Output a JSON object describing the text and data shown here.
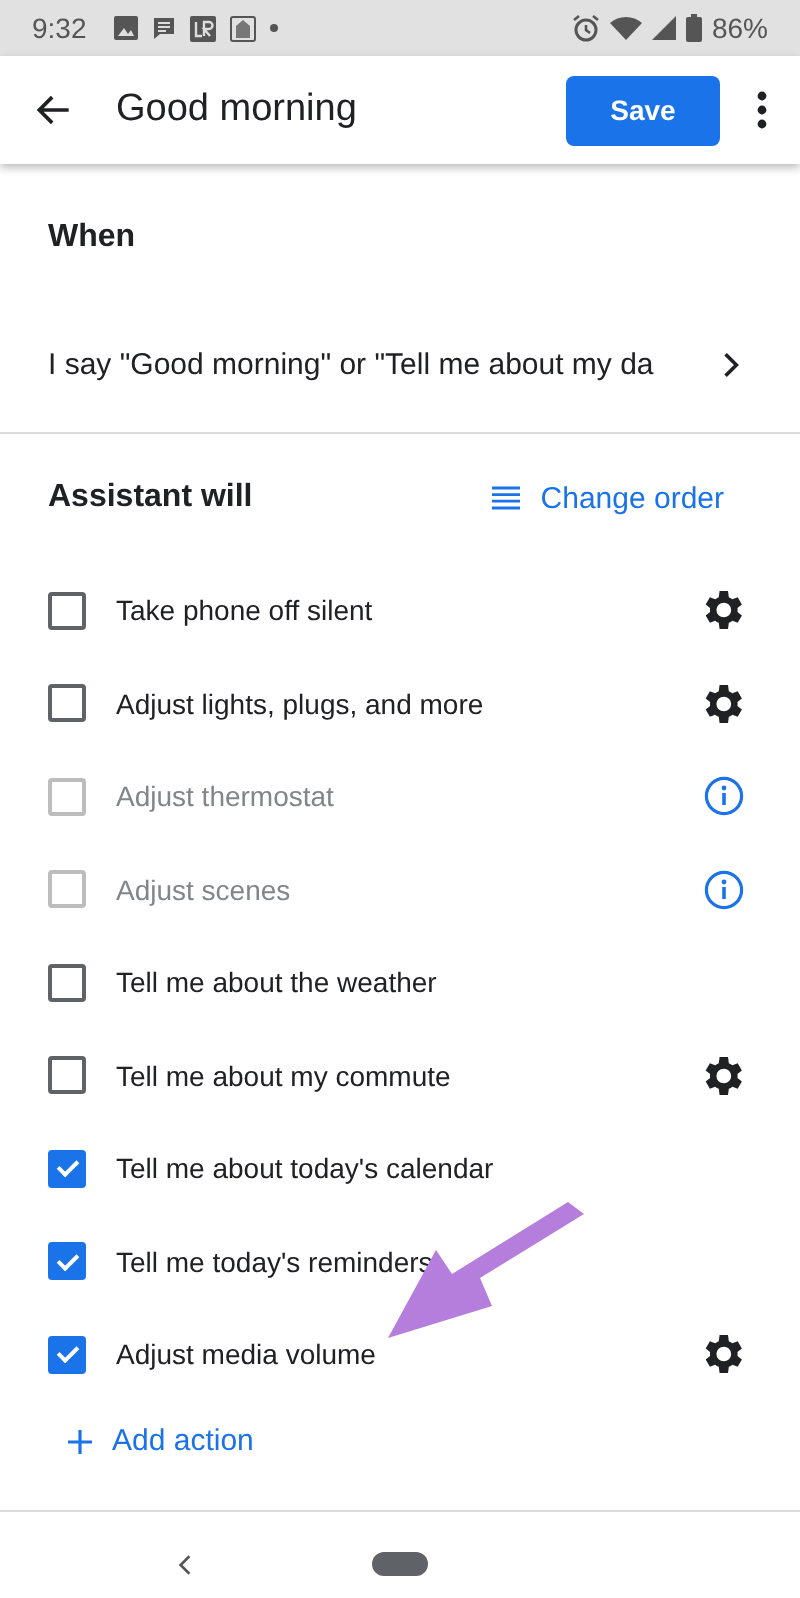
{
  "status_bar": {
    "time": "9:32",
    "battery": "86%"
  },
  "app_bar": {
    "title": "Good morning",
    "save_label": "Save"
  },
  "when": {
    "heading": "When",
    "trigger": "I say \"Good morning\" or \"Tell me about my da"
  },
  "actions_section": {
    "heading": "Assistant will",
    "change_order": "Change order",
    "add_action": "Add action"
  },
  "actions": [
    {
      "label": "Take phone off silent",
      "checked": false,
      "disabled": false,
      "kind": "gear"
    },
    {
      "label": "Adjust lights, plugs, and more",
      "checked": false,
      "disabled": false,
      "kind": "gear"
    },
    {
      "label": "Adjust thermostat",
      "checked": false,
      "disabled": true,
      "kind": "info"
    },
    {
      "label": "Adjust scenes",
      "checked": false,
      "disabled": true,
      "kind": "info"
    },
    {
      "label": "Tell me about the weather",
      "checked": false,
      "disabled": false,
      "kind": "plain"
    },
    {
      "label": "Tell me about my commute",
      "checked": false,
      "disabled": false,
      "kind": "gear"
    },
    {
      "label": "Tell me about today's calendar",
      "checked": true,
      "disabled": false,
      "kind": "plain"
    },
    {
      "label": "Tell me today's reminders",
      "checked": true,
      "disabled": false,
      "kind": "plain"
    },
    {
      "label": "Adjust media volume",
      "checked": true,
      "disabled": false,
      "kind": "gear"
    }
  ]
}
